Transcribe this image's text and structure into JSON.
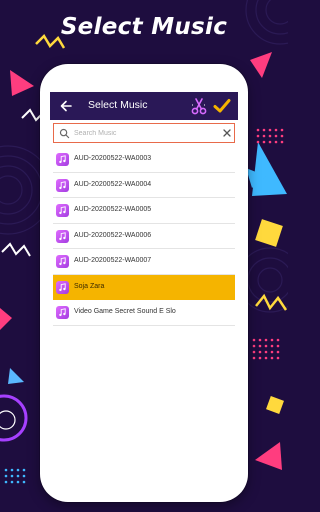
{
  "headline": "Select Music",
  "appbar": {
    "title": "Select Music"
  },
  "search": {
    "placeholder": "Search Music",
    "value": ""
  },
  "songs": [
    {
      "label": "AUD-20200522-WA0003",
      "selected": false
    },
    {
      "label": "AUD-20200522-WA0004",
      "selected": false
    },
    {
      "label": "AUD-20200522-WA0005",
      "selected": false
    },
    {
      "label": "AUD-20200522-WA0006",
      "selected": false
    },
    {
      "label": "AUD-20200522-WA0007",
      "selected": false
    },
    {
      "label": "Soja Zara",
      "selected": true
    },
    {
      "label": "Video Game Secret Sound E Slo",
      "selected": false
    }
  ],
  "colors": {
    "background": "#1e0d3f",
    "appbar": "#2a1857",
    "selected_row": "#f5b400",
    "search_border": "#e86a4a",
    "file_icon": "#c053f0"
  },
  "icons": {
    "back": "arrow-left-icon",
    "scissors": "scissors-icon",
    "confirm": "checkmark-icon",
    "search": "search-icon",
    "clear": "close-icon",
    "song": "music-file-icon"
  }
}
